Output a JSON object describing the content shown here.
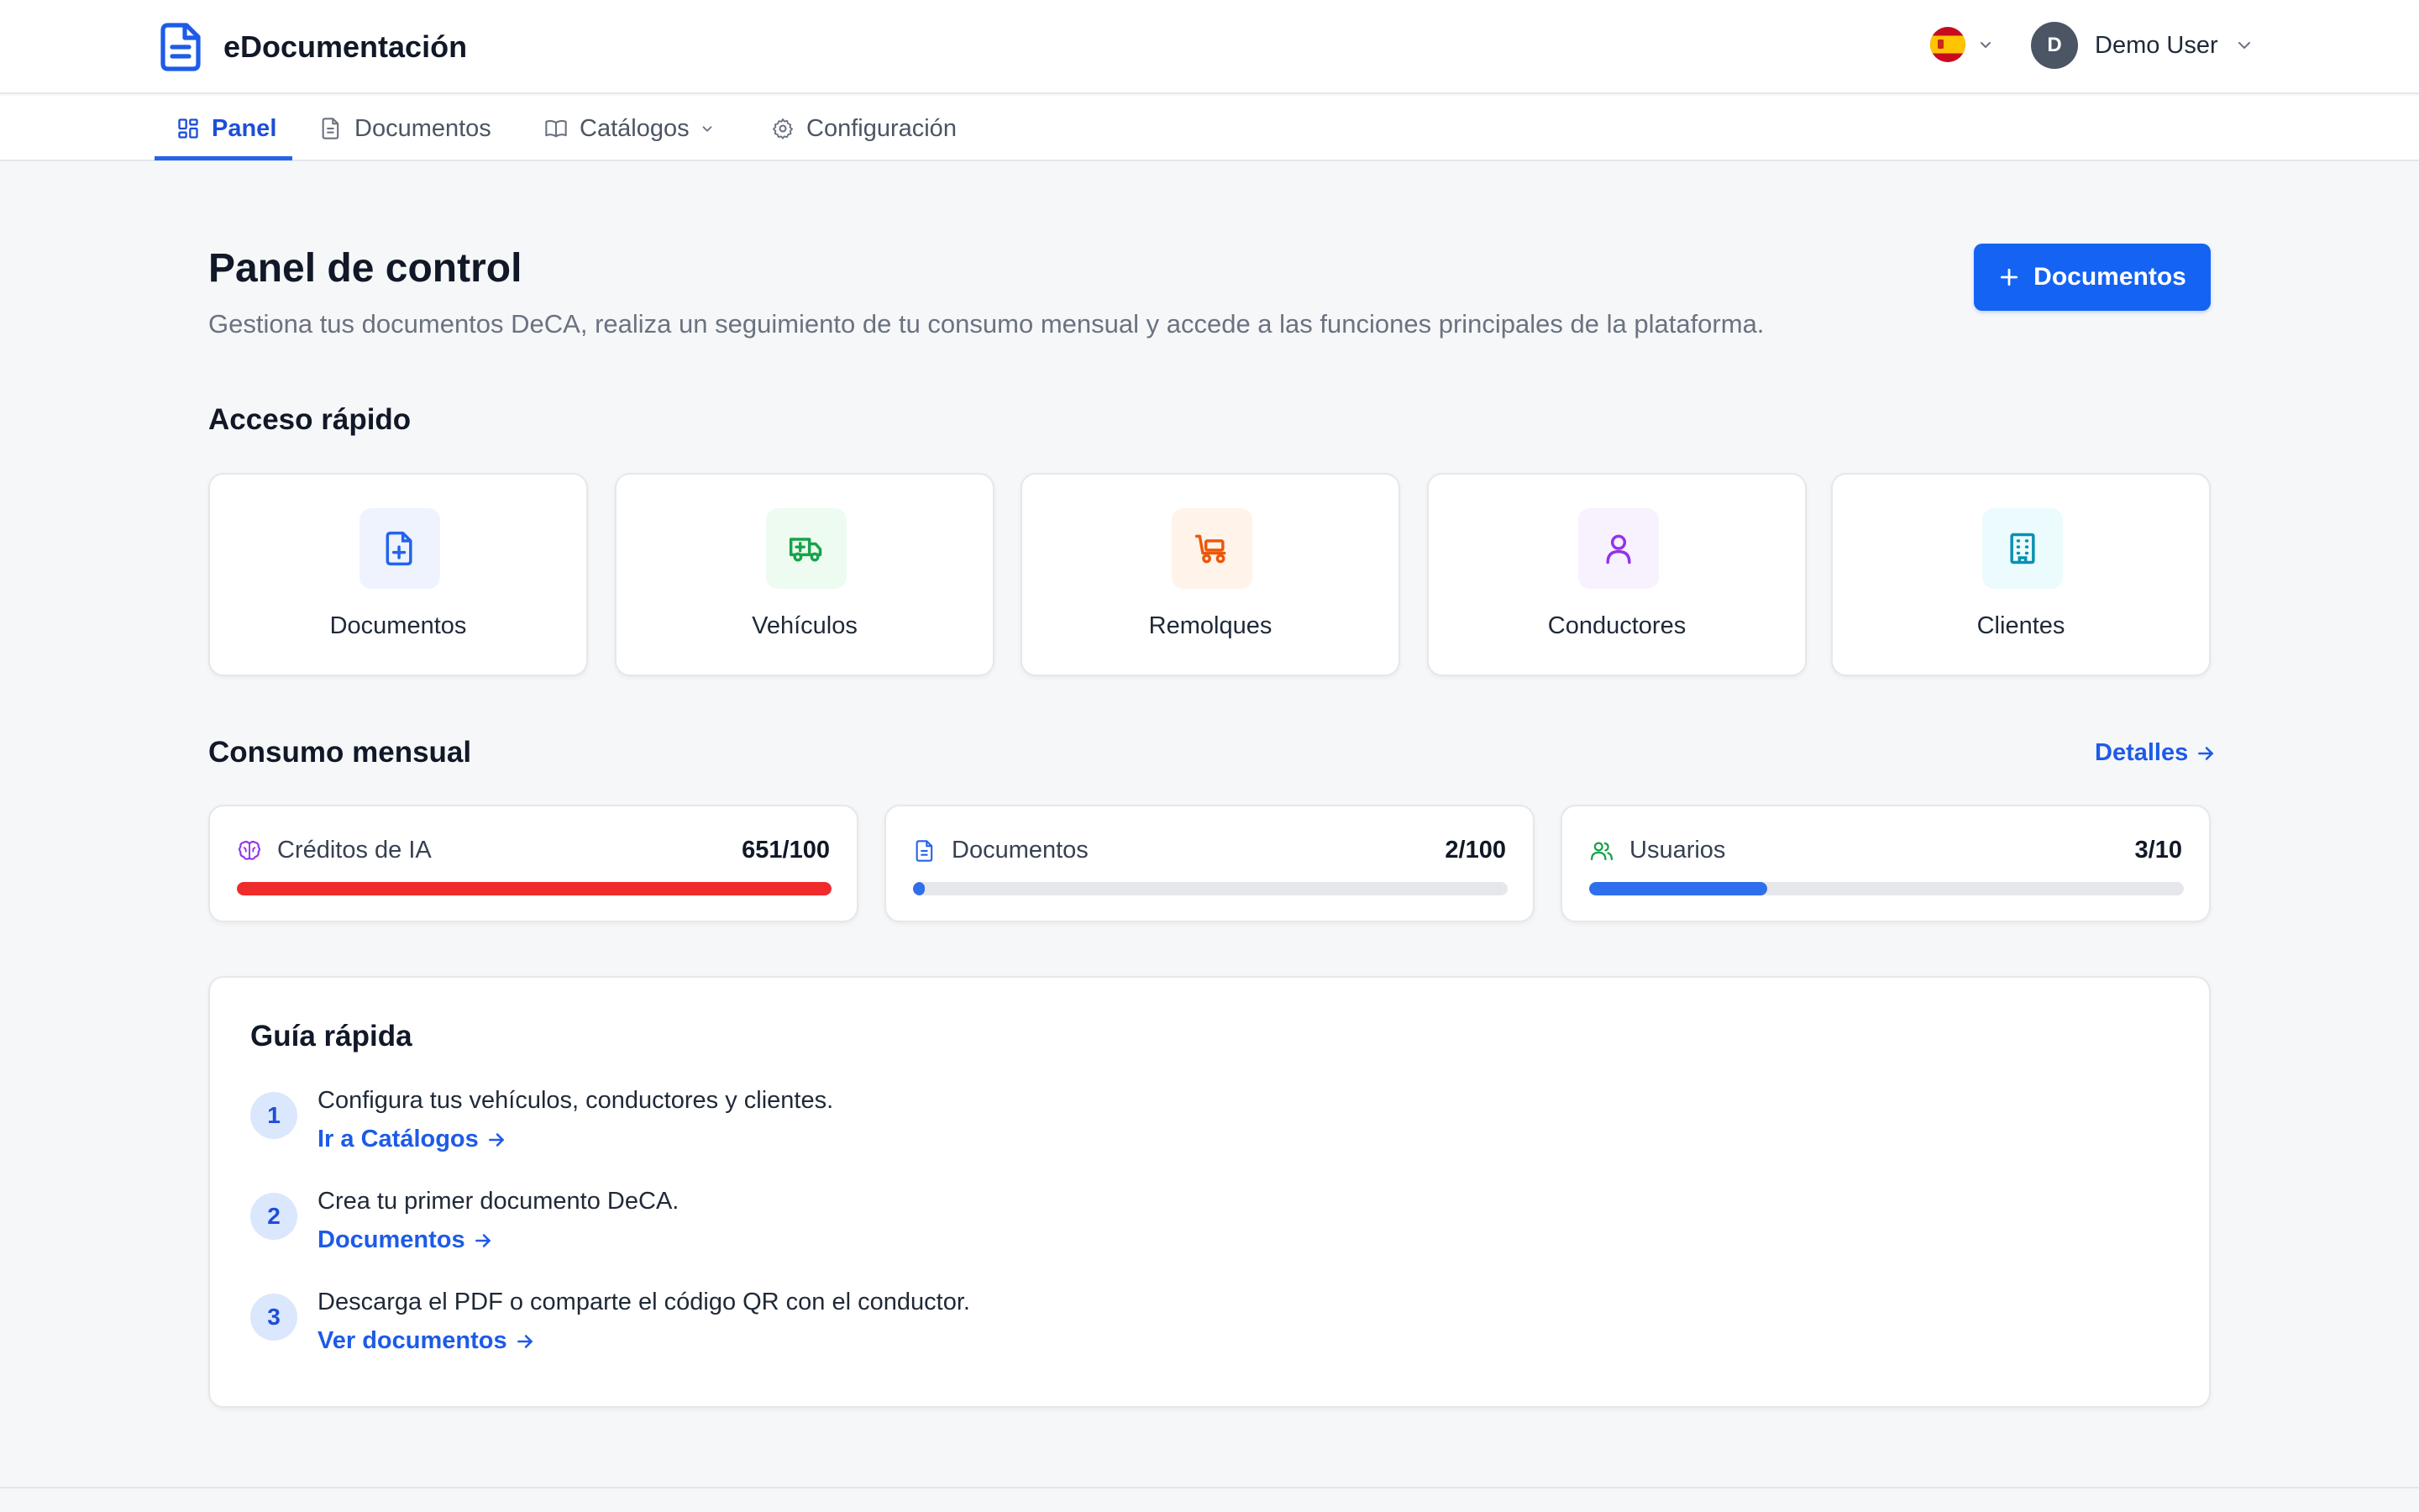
{
  "app": {
    "name": "eDocumentación"
  },
  "header": {
    "user_initial": "D",
    "user_name": "Demo User",
    "language": "es"
  },
  "nav": {
    "items": [
      {
        "label": "Panel",
        "icon": "grid-icon",
        "active": true
      },
      {
        "label": "Documentos",
        "icon": "document-icon"
      },
      {
        "label": "Catálogos",
        "icon": "book-icon",
        "dropdown": true
      },
      {
        "label": "Configuración",
        "icon": "gear-icon"
      }
    ]
  },
  "page": {
    "title": "Panel de control",
    "subtitle": "Gestiona tus documentos DeCA, realiza un seguimiento de tu consumo mensual y accede a las funciones principales de la plataforma.",
    "primary_button": "Documentos"
  },
  "quick_access": {
    "title": "Acceso rápido",
    "items": [
      {
        "label": "Documentos",
        "icon": "document-plus-icon",
        "color": "#2563eb",
        "bg": "#eef3fe"
      },
      {
        "label": "Vehículos",
        "icon": "truck-icon",
        "color": "#16a34a",
        "bg": "#edfbf1"
      },
      {
        "label": "Remolques",
        "icon": "trailer-icon",
        "color": "#ea580c",
        "bg": "#fff3ea"
      },
      {
        "label": "Conductores",
        "icon": "user-icon",
        "color": "#9333ea",
        "bg": "#f8f1fe"
      },
      {
        "label": "Clientes",
        "icon": "building-icon",
        "color": "#0891b2",
        "bg": "#ecfbfd"
      }
    ]
  },
  "consumption": {
    "title": "Consumo mensual",
    "details_link": "Detalles",
    "items": [
      {
        "label": "Créditos de IA",
        "value": "651/100",
        "used": 651,
        "limit": 100,
        "icon": "brain-icon",
        "color": "#ef2b2b",
        "icon_color": "#9333ea"
      },
      {
        "label": "Documentos",
        "value": "2/100",
        "used": 2,
        "limit": 100,
        "icon": "document-icon",
        "color": "#2f6fed",
        "icon_color": "#2563eb"
      },
      {
        "label": "Usuarios",
        "value": "3/10",
        "used": 3,
        "limit": 10,
        "icon": "users-icon",
        "color": "#2f6fed",
        "icon_color": "#16a34a"
      }
    ]
  },
  "guide": {
    "title": "Guía rápida",
    "steps": [
      {
        "number": "1",
        "text": "Configura tus vehículos, conductores y clientes.",
        "link": "Ir a Catálogos"
      },
      {
        "number": "2",
        "text": "Crea tu primer documento DeCA.",
        "link": "Documentos"
      },
      {
        "number": "3",
        "text": "Descarga el PDF o comparte el código QR con el conductor.",
        "link": "Ver documentos"
      }
    ]
  }
}
